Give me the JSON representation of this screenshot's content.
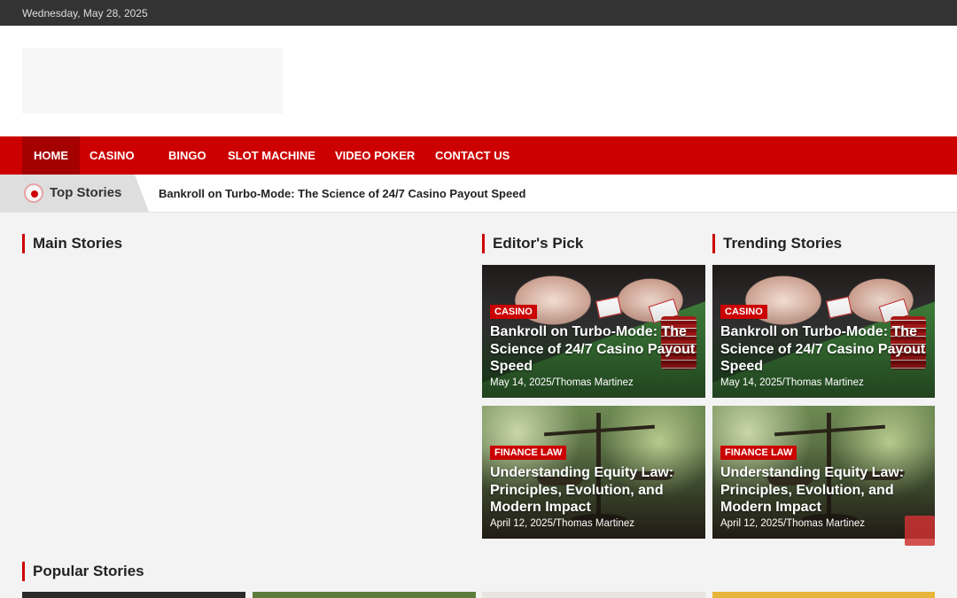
{
  "topbar": {
    "date": "Wednesday, May 28, 2025"
  },
  "nav": {
    "items": [
      {
        "label": "HOME"
      },
      {
        "label": "CASINO"
      },
      {
        "label": "BINGO"
      },
      {
        "label": "SLOT MACHINE"
      },
      {
        "label": "VIDEO POKER"
      },
      {
        "label": "CONTACT US"
      }
    ]
  },
  "ticker": {
    "label": "Top Stories",
    "headline": "Bankroll on Turbo-Mode: The Science of 24/7 Casino Payout Speed"
  },
  "sections": {
    "main": "Main Stories",
    "editors": "Editor's Pick",
    "trending": "Trending Stories",
    "popular": "Popular Stories"
  },
  "editors_pick": [
    {
      "category": "CASINO",
      "title": "Bankroll on Turbo-Mode: The Science of 24/7 Casino Payout Speed",
      "meta": "May 14, 2025/Thomas Martinez"
    },
    {
      "category": "FINANCE LAW",
      "title": "Understanding Equity Law: Principles, Evolution, and Modern Impact",
      "meta": "April 12, 2025/Thomas Martinez"
    }
  ],
  "trending": [
    {
      "category": "CASINO",
      "title": "Bankroll on Turbo-Mode: The Science of 24/7 Casino Payout Speed",
      "meta": "May 14, 2025/Thomas Martinez"
    },
    {
      "category": "FINANCE LAW",
      "title": "Understanding Equity Law: Principles, Evolution, and Modern Impact",
      "meta": "April 12, 2025/Thomas Martinez"
    }
  ],
  "colors": {
    "accent": "#cc0000",
    "topbar": "#333333",
    "nav_active": "#a50000"
  }
}
